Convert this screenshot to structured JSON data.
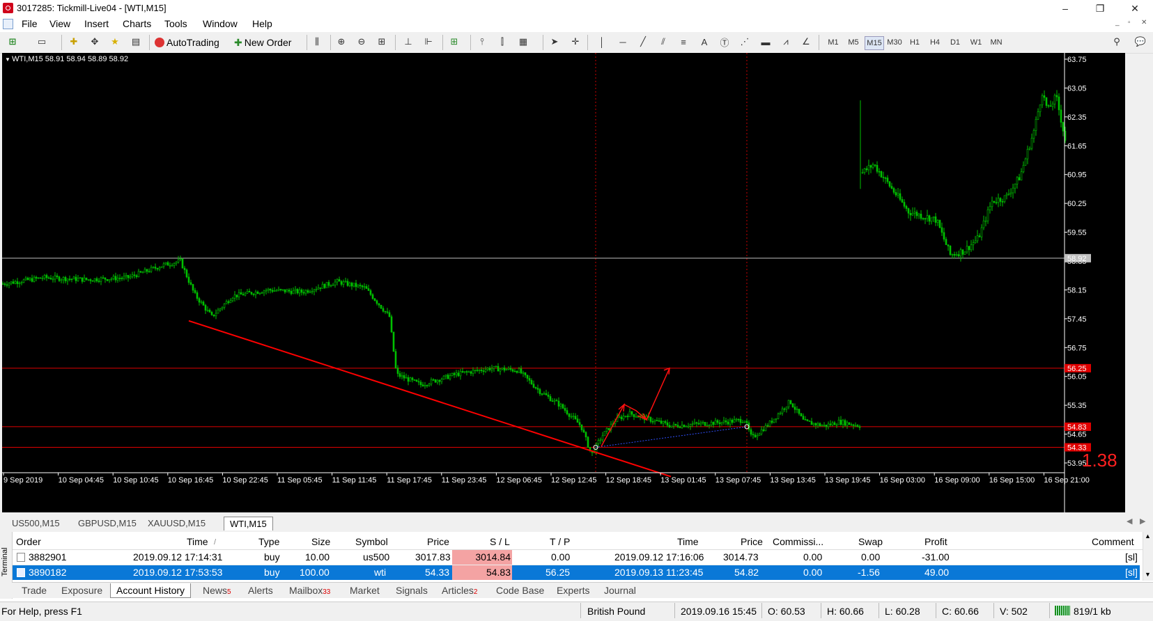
{
  "window": {
    "title": "3017285: Tickmill-Live04 - [WTI,M15]",
    "minimize": "–",
    "restore": "❐",
    "close": "✕"
  },
  "menu": [
    "File",
    "View",
    "Insert",
    "Charts",
    "Tools",
    "Window",
    "Help"
  ],
  "mdi_controls": [
    "_",
    "▫",
    "✕"
  ],
  "toolbar": {
    "autotrading_label": "AutoTrading",
    "new_order_label": "New Order",
    "timeframes": [
      "M1",
      "M5",
      "M15",
      "M30",
      "H1",
      "H4",
      "D1",
      "W1",
      "MN"
    ],
    "active_timeframe": "M15"
  },
  "chart": {
    "header": "WTI,M15  58.91 58.94 58.89 58.92",
    "spread_value": "1.38",
    "price_labels": [
      "63.75",
      "63.05",
      "62.35",
      "61.65",
      "60.95",
      "60.25",
      "59.55",
      "58.85",
      "58.15",
      "57.45",
      "56.75",
      "56.05",
      "55.35",
      "54.65",
      "53.95"
    ],
    "time_labels": [
      "9 Sep 2019",
      "10 Sep 04:45",
      "10 Sep 10:45",
      "10 Sep 16:45",
      "10 Sep 22:45",
      "11 Sep 05:45",
      "11 Sep 11:45",
      "11 Sep 17:45",
      "11 Sep 23:45",
      "12 Sep 06:45",
      "12 Sep 12:45",
      "12 Sep 18:45",
      "13 Sep 01:45",
      "13 Sep 07:45",
      "13 Sep 13:45",
      "13 Sep 19:45",
      "16 Sep 03:00",
      "16 Sep 09:00",
      "16 Sep 15:00",
      "16 Sep 21:00"
    ],
    "current_price_tag": "58.92",
    "take_profit_tag": "56.25",
    "stop_loss_tag": "54.83",
    "entry_tag": "54.33",
    "colors": {
      "background": "#000000",
      "candles": "#00cc00",
      "levels": "#ff0000",
      "current": "#c0c0c0"
    }
  },
  "chart_tabs": [
    "US500,M15",
    "GBPUSD,M15",
    "XAUUSD,M15",
    "WTI,M15"
  ],
  "active_chart_tab": "WTI,M15",
  "terminal": {
    "side_label": "Terminal",
    "columns": [
      "Order",
      "Time",
      "Type",
      "Size",
      "Symbol",
      "Price",
      "S / L",
      "T / P",
      "Time",
      "Price",
      "Commissi...",
      "Swap",
      "Profit",
      "Comment"
    ],
    "time_sort_indicator": "/",
    "rows": [
      {
        "order": "3882901",
        "time": "2019.09.12 17:14:31",
        "type": "buy",
        "size": "10.00",
        "symbol": "us500",
        "price": "3017.83",
        "sl": "3014.84",
        "tp": "0.00",
        "close_time": "2019.09.12 17:16:06",
        "close_price": "3014.73",
        "commission": "0.00",
        "swap": "0.00",
        "profit": "-31.00",
        "comment": "[sl]"
      },
      {
        "order": "3890182",
        "time": "2019.09.12 17:53:53",
        "type": "buy",
        "size": "100.00",
        "symbol": "wti",
        "price": "54.33",
        "sl": "54.83",
        "tp": "56.25",
        "close_time": "2019.09.13 11:23:45",
        "close_price": "54.82",
        "commission": "0.00",
        "swap": "-1.56",
        "profit": "49.00",
        "comment": "[sl]"
      }
    ],
    "tabs": [
      {
        "label": "Trade",
        "badge": ""
      },
      {
        "label": "Exposure",
        "badge": ""
      },
      {
        "label": "Account History",
        "badge": ""
      },
      {
        "label": "News",
        "badge": "5"
      },
      {
        "label": "Alerts",
        "badge": ""
      },
      {
        "label": "Mailbox",
        "badge": "33"
      },
      {
        "label": "Market",
        "badge": ""
      },
      {
        "label": "Signals",
        "badge": ""
      },
      {
        "label": "Articles",
        "badge": "2"
      },
      {
        "label": "Code Base",
        "badge": ""
      },
      {
        "label": "Experts",
        "badge": ""
      },
      {
        "label": "Journal",
        "badge": ""
      }
    ],
    "active_tab": "Account History"
  },
  "statusbar": {
    "help": "For Help, press F1",
    "profile": "British Pound",
    "datetime": "2019.09.16 15:45",
    "open": "O: 60.53",
    "high": "H: 60.66",
    "low": "L: 60.28",
    "close": "C: 60.66",
    "volume": "V: 502",
    "traffic": "819/1 kb"
  }
}
